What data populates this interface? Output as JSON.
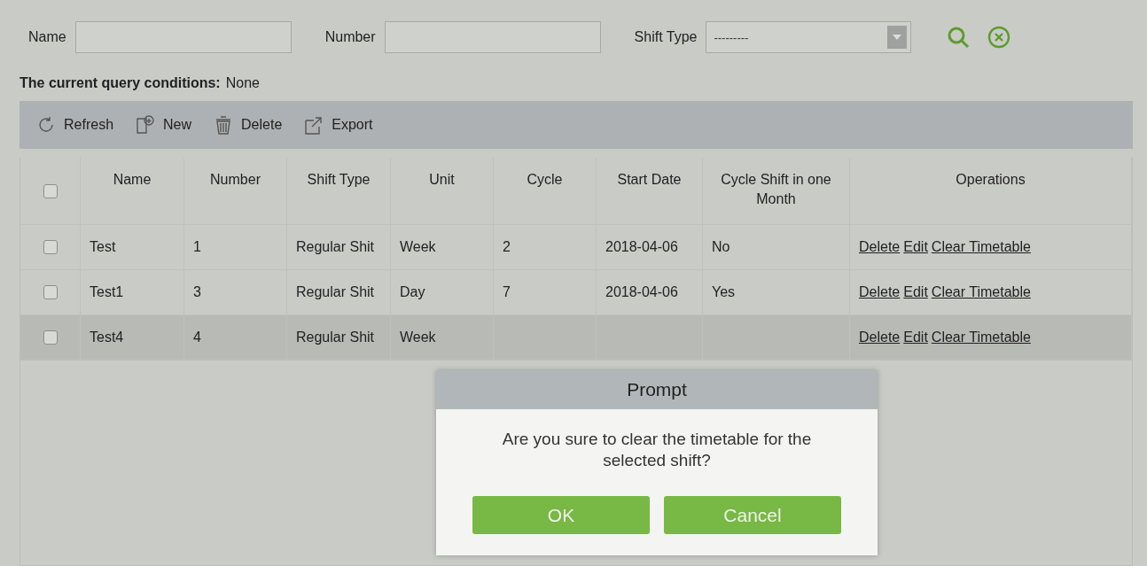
{
  "filters": [
    {
      "kind": "text",
      "label": "Name"
    },
    {
      "kind": "text",
      "label": "Number"
    },
    {
      "kind": "select",
      "label": "Shift Type",
      "value": "---------"
    }
  ],
  "query_conditions": {
    "label": "The current query conditions:",
    "value": "None"
  },
  "toolbar": [
    {
      "kind": "refresh",
      "label": "Refresh"
    },
    {
      "kind": "new",
      "label": "New"
    },
    {
      "kind": "delete",
      "label": "Delete"
    },
    {
      "kind": "export",
      "label": "Export"
    }
  ],
  "table": {
    "select_all_checked": false,
    "columns": [
      "Name",
      "Number",
      "Shift Type",
      "Unit",
      "Cycle",
      "Start Date",
      "Cycle Shift in one Month",
      "Operations"
    ],
    "rows": [
      {
        "checked": false,
        "highlighted": false,
        "cells": [
          "Test",
          "1",
          "Regular Shit",
          "Week",
          "2",
          "2018-04-06",
          "No"
        ],
        "operations": [
          "Delete",
          "Edit",
          "Clear Timetable"
        ]
      },
      {
        "checked": false,
        "highlighted": false,
        "cells": [
          "Test1",
          "3",
          "Regular Shit",
          "Day",
          "7",
          "2018-04-06",
          "Yes"
        ],
        "operations": [
          "Delete",
          "Edit",
          "Clear Timetable"
        ]
      },
      {
        "checked": false,
        "highlighted": true,
        "cells": [
          "Test4",
          "4",
          "Regular Shit",
          "Week",
          null,
          null,
          null
        ],
        "operations": [
          "Delete",
          "Edit",
          "Clear Timetable"
        ]
      }
    ]
  },
  "dialog": {
    "title": "Prompt",
    "message": "Are you sure to clear the timetable for the selected shift?",
    "buttons": [
      "OK",
      "Cancel"
    ]
  }
}
